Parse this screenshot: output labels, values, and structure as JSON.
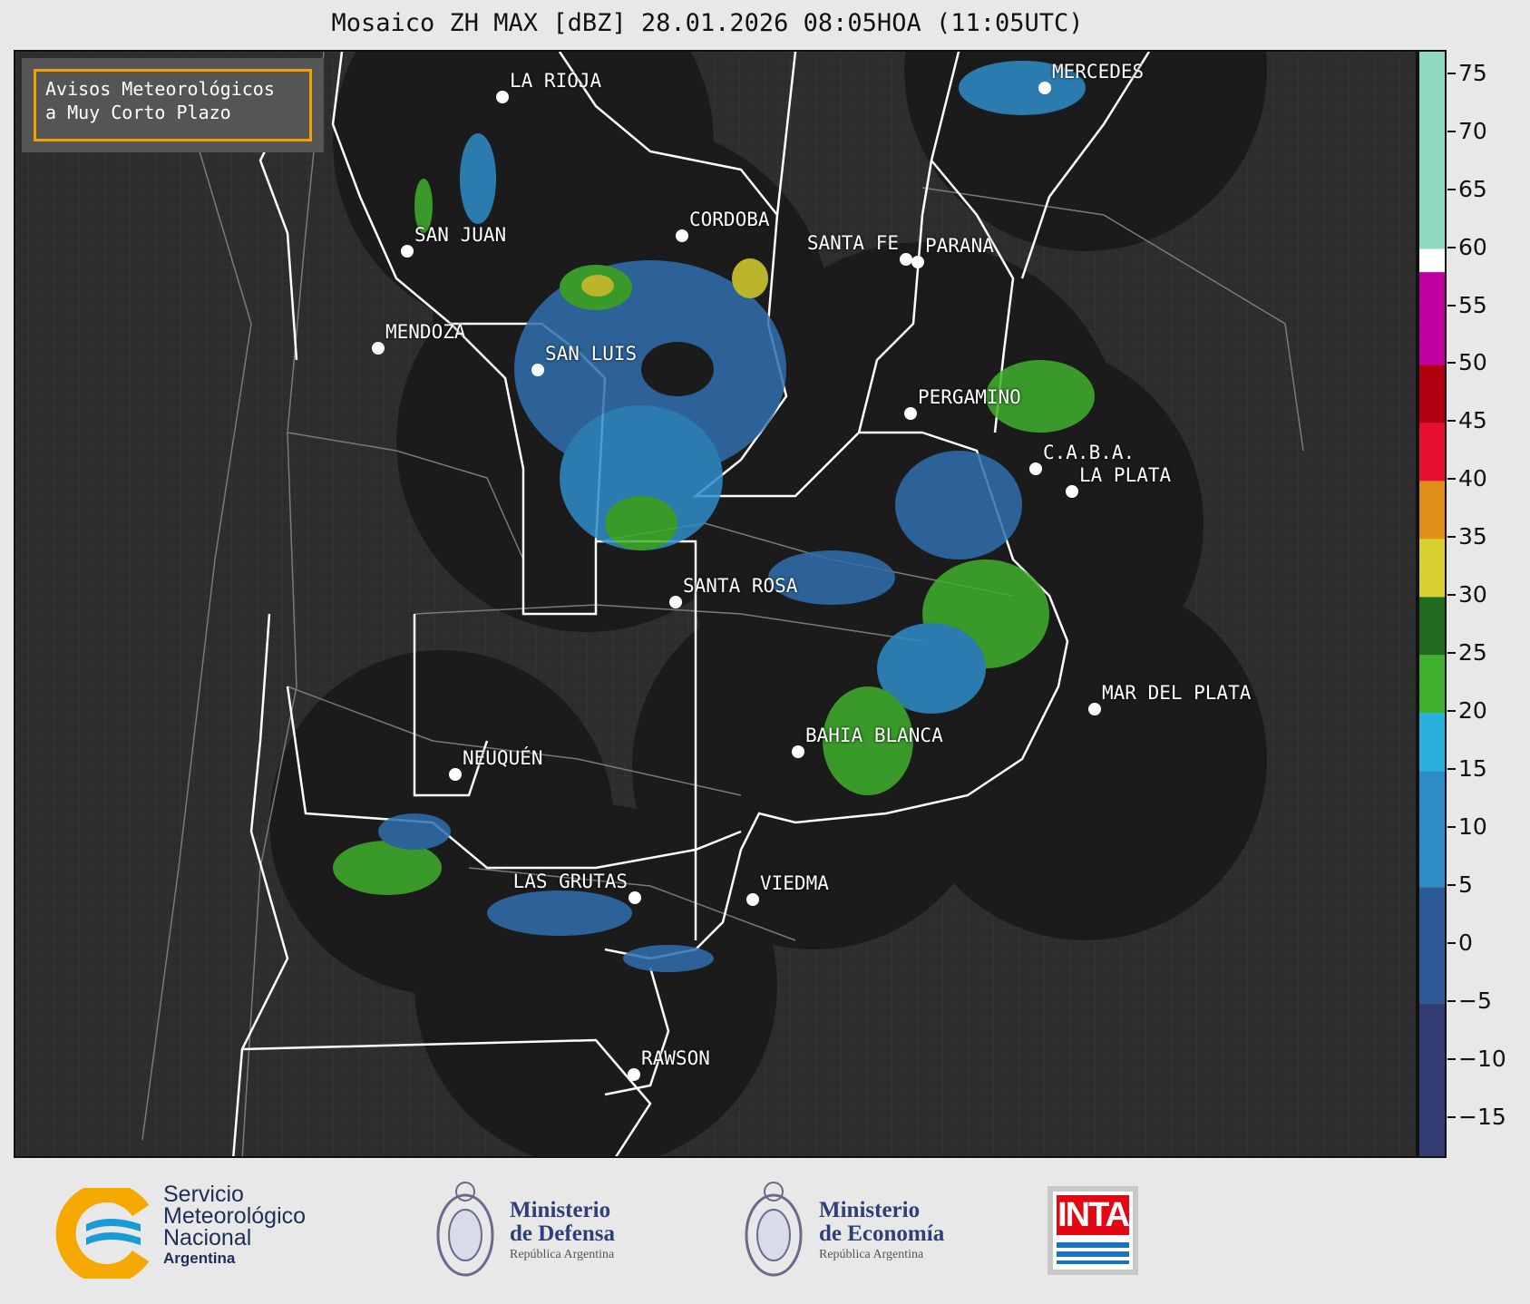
{
  "header": {
    "title": "Mosaico ZH MAX [dBZ] 28.01.2026 08:05HOA (11:05UTC)"
  },
  "notice": {
    "line1": "Avisos Meteorológicos",
    "line2": "a Muy Corto Plazo"
  },
  "map": {
    "cities": [
      {
        "name": "LA RIOJA"
      },
      {
        "name": "MERCEDES"
      },
      {
        "name": "SAN JUAN"
      },
      {
        "name": "CORDOBA"
      },
      {
        "name": "SANTA FE"
      },
      {
        "name": "PARANA"
      },
      {
        "name": "MENDOZA"
      },
      {
        "name": "SAN LUIS"
      },
      {
        "name": "PERGAMINO"
      },
      {
        "name": "C.A.B.A."
      },
      {
        "name": "LA PLATA"
      },
      {
        "name": "SANTA ROSA"
      },
      {
        "name": "MAR DEL PLATA"
      },
      {
        "name": "BAHIA BLANCA"
      },
      {
        "name": "NEUQUÉN"
      },
      {
        "name": "LAS GRUTAS"
      },
      {
        "name": "VIEDMA"
      },
      {
        "name": "RAWSON"
      }
    ]
  },
  "colorbar": {
    "unit": "dBZ",
    "range": [
      -18.5,
      77
    ],
    "ticks": [
      "75",
      "70",
      "65",
      "60",
      "55",
      "50",
      "45",
      "40",
      "35",
      "30",
      "25",
      "20",
      "15",
      "10",
      "5",
      "0",
      "−5",
      "−10",
      "−15"
    ],
    "tick_values": [
      75,
      70,
      65,
      60,
      55,
      50,
      45,
      40,
      35,
      30,
      25,
      20,
      15,
      10,
      5,
      0,
      -5,
      -10,
      -15
    ],
    "bands": [
      {
        "from": 60,
        "to": 77,
        "color": "#8fd9c0"
      },
      {
        "from": 58,
        "to": 60,
        "color": "#ffffff"
      },
      {
        "from": 50,
        "to": 58,
        "color": "#c000a0"
      },
      {
        "from": 45,
        "to": 50,
        "color": "#b00010"
      },
      {
        "from": 40,
        "to": 45,
        "color": "#e81030"
      },
      {
        "from": 35,
        "to": 40,
        "color": "#e09018"
      },
      {
        "from": 30,
        "to": 35,
        "color": "#d8d030"
      },
      {
        "from": 25,
        "to": 30,
        "color": "#1f6a1f"
      },
      {
        "from": 20,
        "to": 25,
        "color": "#3fb02c"
      },
      {
        "from": 15,
        "to": 20,
        "color": "#2ab0dd"
      },
      {
        "from": 5,
        "to": 15,
        "color": "#2d8cc8"
      },
      {
        "from": -5,
        "to": 5,
        "color": "#2f5a99"
      },
      {
        "from": -18.5,
        "to": -5,
        "color": "#323c72"
      }
    ]
  },
  "footer": {
    "smn": {
      "line1": "Servicio",
      "line2": "Meteorológico",
      "line3": "Nacional",
      "sub": "Argentina",
      "accent": "#f5a800",
      "blue": "#1a9ad6"
    },
    "defensa": {
      "title1": "Ministerio",
      "title2": "de Defensa",
      "sub": "República Argentina"
    },
    "economia": {
      "title1": "Ministerio",
      "title2": "de Economía",
      "sub": "República Argentina"
    },
    "inta": {
      "label": "INTA"
    }
  }
}
